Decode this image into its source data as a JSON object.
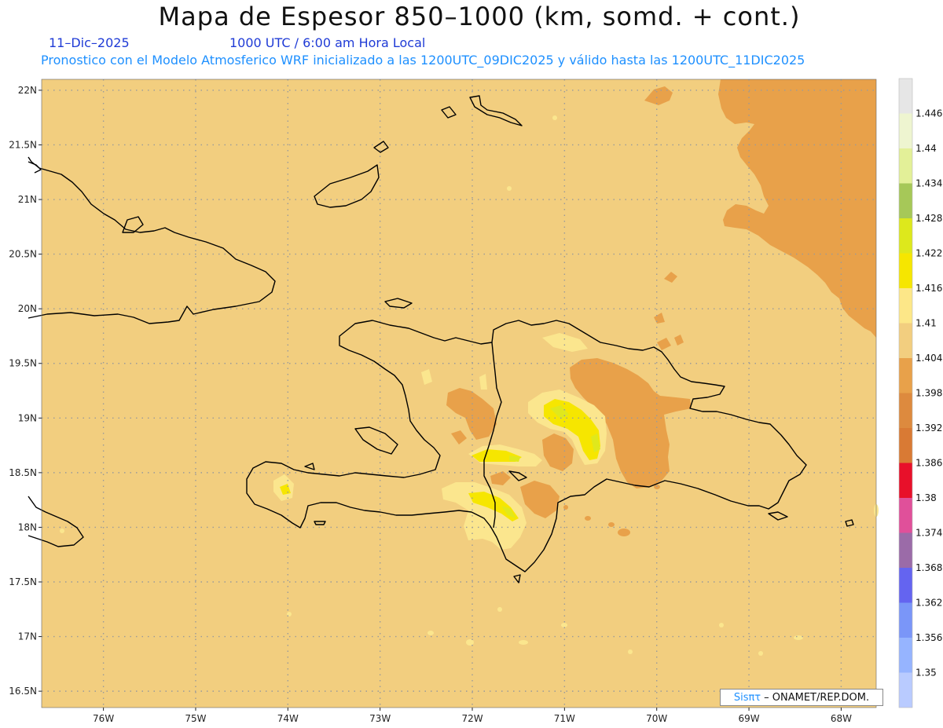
{
  "header": {
    "title": "Mapa de Espesor 850–1000 (km, somd. + cont.)",
    "date": "11–Dic–2025",
    "time": "1000 UTC / 6:00 am Hora Local",
    "model_info": "Pronostico con el Modelo Atmosferico WRF inicializado a las 1200UTC_09DIC2025 y válido hasta las  1200UTC_11DIC2025"
  },
  "map": {
    "lat_labels": [
      "22N",
      "21.5N",
      "21N",
      "20.5N",
      "20N",
      "19.5N",
      "19N",
      "18.5N",
      "18N",
      "17.5N",
      "17N",
      "16.5N"
    ],
    "lon_labels": [
      "76W",
      "75W",
      "74W",
      "73W",
      "72W",
      "71W",
      "70W",
      "69W",
      "68W"
    ],
    "lat_values": [
      22,
      21.5,
      21,
      20.5,
      20,
      19.5,
      19,
      18.5,
      18,
      17.5,
      17,
      16.5
    ],
    "lon_values": [
      -76,
      -75,
      -74,
      -73,
      -72,
      -71,
      -70,
      -69,
      -68
    ],
    "lat_range": [
      16.35,
      22.1
    ],
    "lon_range": [
      -76.67,
      -67.62
    ],
    "colors": {
      "band_1404_1410": "#f2ce7f",
      "band_1398_1404": "#e8a14a",
      "band_1392_1398": "#dd8a3e",
      "band_1410_1416": "#fbe68e",
      "band_1416_1422": "#f6e600",
      "band_1422_1428": "#e0e81c",
      "coast": "#000000",
      "grid": "#9a9a9a"
    }
  },
  "legend": {
    "values": [
      "1.446",
      "1.44",
      "1.434",
      "1.428",
      "1.422",
      "1.416",
      "1.41",
      "1.404",
      "1.398",
      "1.392",
      "1.386",
      "1.38",
      "1.374",
      "1.368",
      "1.362",
      "1.356",
      "1.35"
    ],
    "colors": [
      "#e6e6e6",
      "#eef5d0",
      "#e3f098",
      "#a6c858",
      "#dde81c",
      "#f6e600",
      "#fde788",
      "#f2ce7f",
      "#e8a14a",
      "#dd8a3e",
      "#d97a34",
      "#e8102a",
      "#e0509a",
      "#9b6ba8",
      "#6464f0",
      "#7a96f8",
      "#96b4ff",
      "#b9cbff"
    ]
  },
  "credit": {
    "brand": "Sisπτ",
    "org": "– ONAMET/REP.DOM."
  }
}
